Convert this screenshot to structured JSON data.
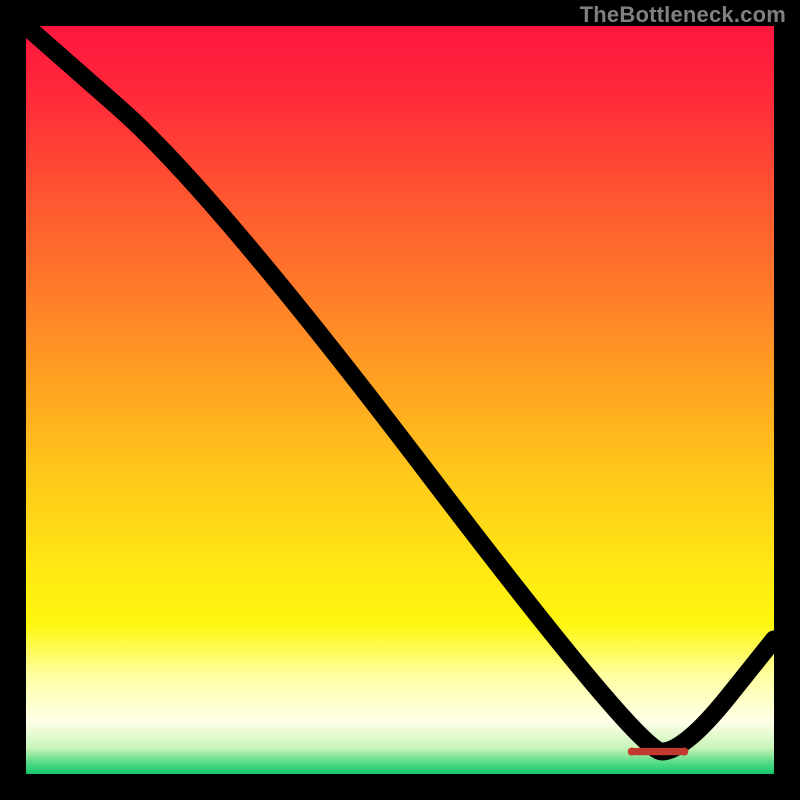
{
  "attribution": "TheBottleneck.com",
  "colors": {
    "page_bg": "#000000",
    "watermark": "#808080",
    "line": "#000000",
    "marker": "#c23a2d",
    "gradient_stops": [
      {
        "offset": 0.0,
        "color": "#ff163f"
      },
      {
        "offset": 0.1,
        "color": "#ff2b3a"
      },
      {
        "offset": 0.22,
        "color": "#ff5331"
      },
      {
        "offset": 0.35,
        "color": "#ff7a2a"
      },
      {
        "offset": 0.48,
        "color": "#ffa321"
      },
      {
        "offset": 0.6,
        "color": "#ffc81a"
      },
      {
        "offset": 0.72,
        "color": "#ffe714"
      },
      {
        "offset": 0.8,
        "color": "#fff70f"
      },
      {
        "offset": 0.87,
        "color": "#ffffa5"
      },
      {
        "offset": 0.93,
        "color": "#ffffe8"
      },
      {
        "offset": 0.965,
        "color": "#c8f5b8"
      },
      {
        "offset": 0.985,
        "color": "#55db86"
      },
      {
        "offset": 1.0,
        "color": "#12c86f"
      }
    ]
  },
  "chart_data": {
    "type": "line",
    "title": "",
    "xlabel": "",
    "ylabel": "",
    "xlim": [
      0,
      100
    ],
    "ylim": [
      0,
      100
    ],
    "grid": false,
    "legend": false,
    "x": [
      0,
      25,
      82,
      88,
      100
    ],
    "series": [
      {
        "name": "bottleneck-curve",
        "values": [
          100,
          78,
          3,
          3,
          18
        ]
      }
    ],
    "markers": {
      "bar": {
        "x_start": 81,
        "x_end": 88,
        "y": 3
      },
      "dots": [
        {
          "x": 81,
          "y": 3
        },
        {
          "x": 88,
          "y": 3
        }
      ]
    }
  }
}
